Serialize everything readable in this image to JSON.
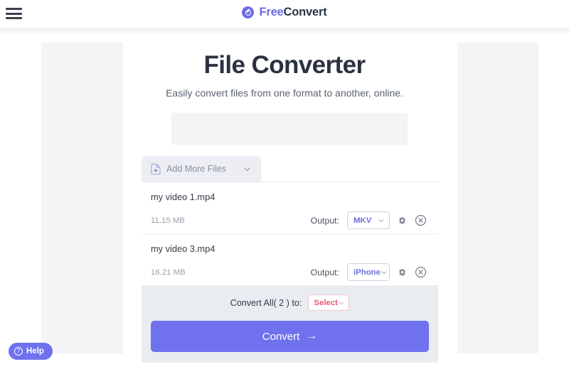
{
  "header": {
    "menu_icon": "hamburger-menu-icon",
    "brand": {
      "logo_icon": "freeconvert-circle-logo-icon",
      "name_part1": "Free",
      "name_part2": "Convert"
    }
  },
  "hero": {
    "title": "File Converter",
    "subtitle": "Easily convert files from one format to another, online."
  },
  "converter": {
    "add_more": {
      "label": "Add More Files",
      "file_icon": "file-plus-icon",
      "chevron_icon": "chevron-down-icon"
    },
    "output_label": "Output:",
    "files": [
      {
        "name": "my video 1.mp4",
        "size": "11.15 MB",
        "output_format": "MKV",
        "settings_icon": "gear-icon",
        "remove_icon": "close-circle-icon"
      },
      {
        "name": "my video 3.mp4",
        "size": "16.21 MB",
        "output_format": "iPhone",
        "settings_icon": "gear-icon",
        "remove_icon": "close-circle-icon"
      }
    ],
    "convert_all": {
      "label": "Convert All( 2 ) to:",
      "select_value": "Select",
      "chevron_icon": "chevron-down-icon"
    },
    "convert_button": {
      "label": "Convert",
      "arrow_icon": "arrow-right-icon"
    }
  },
  "help": {
    "label": "Help",
    "icon": "question-circle-icon"
  },
  "colors": {
    "brand_purple": "#6c6ce5",
    "brand_navy": "#2b3445",
    "convert_button": "#6f71ee",
    "select_pink": "#e4587a",
    "format_purple": "#6d6fe0",
    "panel_gray": "#e9ecf1",
    "placeholder_gray": "#f4f4f6"
  }
}
